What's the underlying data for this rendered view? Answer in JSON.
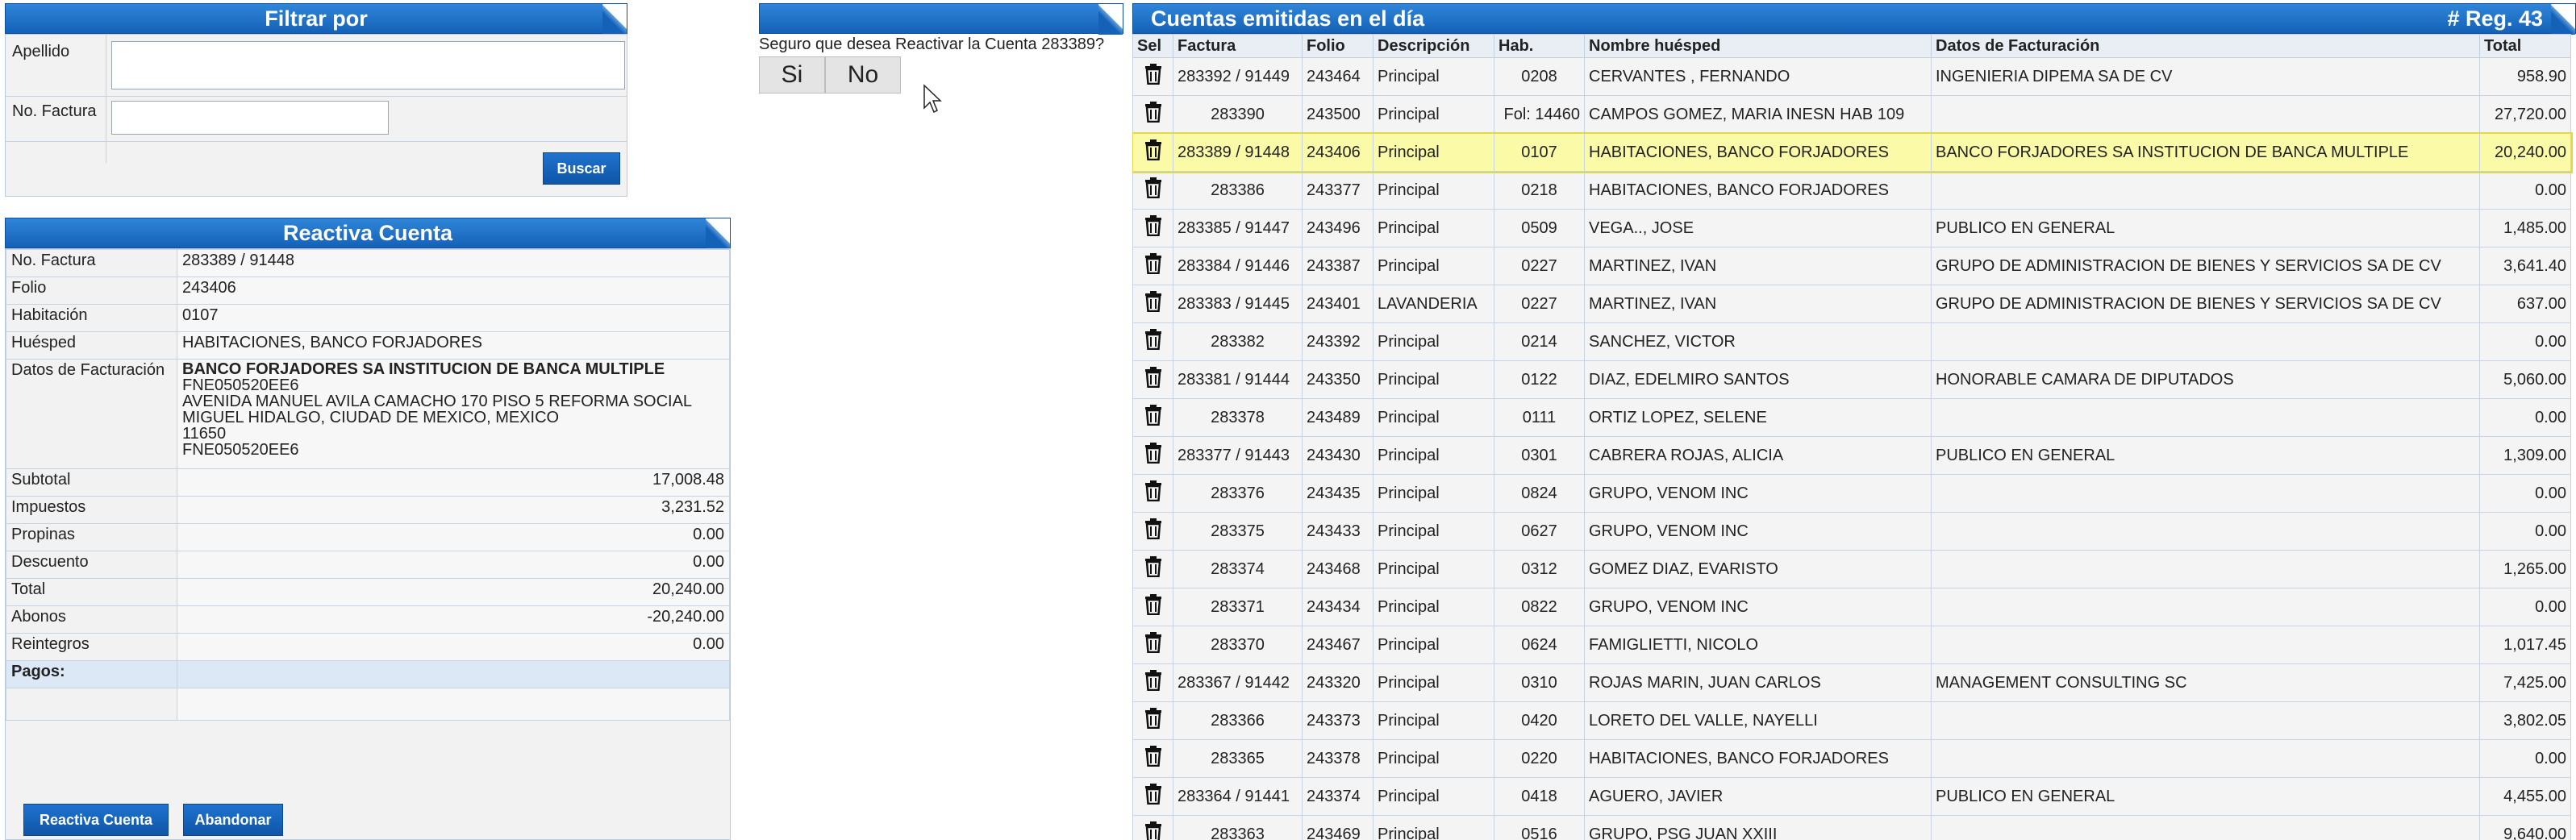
{
  "filter": {
    "title": "Filtrar por",
    "apellido_label": "Apellido",
    "apellido_value": "",
    "factura_label": "No. Factura",
    "factura_value": "",
    "search_button": "Buscar"
  },
  "confirm": {
    "question": "Seguro que desea Reactivar la Cuenta 283389?",
    "yes": "Si",
    "no": "No"
  },
  "reactiva": {
    "title": "Reactiva Cuenta",
    "fields": [
      {
        "k": "No. Factura",
        "v": "283389 / 91448"
      },
      {
        "k": "Folio",
        "v": "243406"
      },
      {
        "k": "Habitación",
        "v": "0107"
      },
      {
        "k": "Huésped",
        "v": "HABITACIONES, BANCO FORJADORES"
      }
    ],
    "billing_label": "Datos de Facturación",
    "billing": {
      "name": "BANCO FORJADORES SA INSTITUCION DE BANCA MULTIPLE",
      "line1": "FNE050520EE6",
      "line2": "AVENIDA MANUEL AVILA CAMACHO 170 PISO 5 REFORMA SOCIAL",
      "line3": "MIGUEL HIDALGO, CIUDAD DE MEXICO, MEXICO",
      "line4": "11650",
      "line5": "FNE050520EE6"
    },
    "totals": [
      {
        "k": "Subtotal",
        "v": "17,008.48"
      },
      {
        "k": "Impuestos",
        "v": "3,231.52"
      },
      {
        "k": "Propinas",
        "v": "0.00"
      },
      {
        "k": "Descuento",
        "v": "0.00"
      },
      {
        "k": "Total",
        "v": "20,240.00"
      },
      {
        "k": "Abonos",
        "v": "-20,240.00"
      },
      {
        "k": "Reintegros",
        "v": "0.00"
      }
    ],
    "pagos_label": "Pagos:",
    "reactivate_button": "Reactiva Cuenta",
    "abandon_button": "Abandonar"
  },
  "list": {
    "title": "Cuentas emitidas en el día",
    "count": "# Reg. 43",
    "headers": {
      "sel": "Sel",
      "factura": "Factura",
      "folio": "Folio",
      "descripcion": "Descripción",
      "hab": "Hab.",
      "nombre": "Nombre huésped",
      "datos": "Datos de Facturación",
      "total": "Total"
    },
    "rows": [
      {
        "factura": "283392 / 91449",
        "folio": "243464",
        "desc": "Principal",
        "hab": "0208",
        "nombre": "CERVANTES , FERNANDO",
        "datos": "INGENIERIA DIPEMA SA DE CV",
        "total": "958.90"
      },
      {
        "factura": "283390",
        "folio": "243500",
        "desc": "Principal",
        "hab": "Fol: 14460",
        "nombre": "CAMPOS GOMEZ, MARIA INESN HAB 109",
        "datos": "",
        "total": "27,720.00"
      },
      {
        "factura": "283389 / 91448",
        "folio": "243406",
        "desc": "Principal",
        "hab": "0107",
        "nombre": "HABITACIONES, BANCO FORJADORES",
        "datos": "BANCO FORJADORES SA INSTITUCION DE BANCA MULTIPLE",
        "total": "20,240.00",
        "selected": true
      },
      {
        "factura": "283386",
        "folio": "243377",
        "desc": "Principal",
        "hab": "0218",
        "nombre": "HABITACIONES, BANCO FORJADORES",
        "datos": "",
        "total": "0.00"
      },
      {
        "factura": "283385 / 91447",
        "folio": "243496",
        "desc": "Principal",
        "hab": "0509",
        "nombre": "VEGA.., JOSE",
        "datos": "PUBLICO EN GENERAL",
        "total": "1,485.00"
      },
      {
        "factura": "283384 / 91446",
        "folio": "243387",
        "desc": "Principal",
        "hab": "0227",
        "nombre": "MARTINEZ, IVAN",
        "datos": "GRUPO DE ADMINISTRACION DE BIENES Y SERVICIOS SA DE CV",
        "total": "3,641.40"
      },
      {
        "factura": "283383 / 91445",
        "folio": "243401",
        "desc": "LAVANDERIA",
        "hab": "0227",
        "nombre": "MARTINEZ, IVAN",
        "datos": "GRUPO DE ADMINISTRACION DE BIENES Y SERVICIOS SA DE CV",
        "total": "637.00"
      },
      {
        "factura": "283382",
        "folio": "243392",
        "desc": "Principal",
        "hab": "0214",
        "nombre": "SANCHEZ, VICTOR",
        "datos": "",
        "total": "0.00"
      },
      {
        "factura": "283381 / 91444",
        "folio": "243350",
        "desc": "Principal",
        "hab": "0122",
        "nombre": "DIAZ, EDELMIRO SANTOS",
        "datos": "HONORABLE CAMARA DE DIPUTADOS",
        "total": "5,060.00"
      },
      {
        "factura": "283378",
        "folio": "243489",
        "desc": "Principal",
        "hab": "0111",
        "nombre": "ORTIZ LOPEZ, SELENE",
        "datos": "",
        "total": "0.00"
      },
      {
        "factura": "283377 / 91443",
        "folio": "243430",
        "desc": "Principal",
        "hab": "0301",
        "nombre": "CABRERA ROJAS, ALICIA",
        "datos": "PUBLICO EN GENERAL",
        "total": "1,309.00"
      },
      {
        "factura": "283376",
        "folio": "243435",
        "desc": "Principal",
        "hab": "0824",
        "nombre": "GRUPO, VENOM INC",
        "datos": "",
        "total": "0.00"
      },
      {
        "factura": "283375",
        "folio": "243433",
        "desc": "Principal",
        "hab": "0627",
        "nombre": "GRUPO, VENOM INC",
        "datos": "",
        "total": "0.00"
      },
      {
        "factura": "283374",
        "folio": "243468",
        "desc": "Principal",
        "hab": "0312",
        "nombre": "GOMEZ DIAZ, EVARISTO",
        "datos": "",
        "total": "1,265.00"
      },
      {
        "factura": "283371",
        "folio": "243434",
        "desc": "Principal",
        "hab": "0822",
        "nombre": "GRUPO, VENOM INC",
        "datos": "",
        "total": "0.00"
      },
      {
        "factura": "283370",
        "folio": "243467",
        "desc": "Principal",
        "hab": "0624",
        "nombre": "FAMIGLIETTI, NICOLO",
        "datos": "",
        "total": "1,017.45"
      },
      {
        "factura": "283367 / 91442",
        "folio": "243320",
        "desc": "Principal",
        "hab": "0310",
        "nombre": "ROJAS MARIN, JUAN CARLOS",
        "datos": "MANAGEMENT CONSULTING SC",
        "total": "7,425.00"
      },
      {
        "factura": "283366",
        "folio": "243373",
        "desc": "Principal",
        "hab": "0420",
        "nombre": "LORETO DEL VALLE, NAYELLI",
        "datos": "",
        "total": "3,802.05"
      },
      {
        "factura": "283365",
        "folio": "243378",
        "desc": "Principal",
        "hab": "0220",
        "nombre": "HABITACIONES, BANCO FORJADORES",
        "datos": "",
        "total": "0.00"
      },
      {
        "factura": "283364 / 91441",
        "folio": "243374",
        "desc": "Principal",
        "hab": "0418",
        "nombre": "AGUERO, JAVIER",
        "datos": "PUBLICO EN GENERAL",
        "total": "4,455.00"
      },
      {
        "factura": "283363",
        "folio": "243469",
        "desc": "Principal",
        "hab": "0516",
        "nombre": "GRUPO, PSG JUAN XXIII",
        "datos": "",
        "total": "9,640.00"
      }
    ]
  }
}
